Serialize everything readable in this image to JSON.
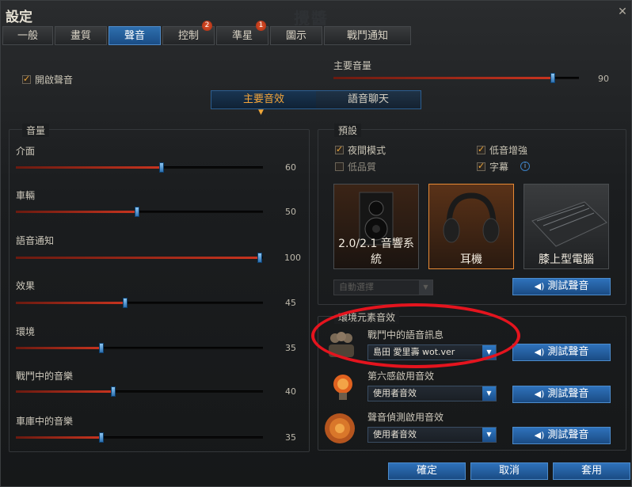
{
  "window": {
    "title": "設定",
    "watermark": "攪醬"
  },
  "tabs": [
    {
      "label": "一般",
      "active": false
    },
    {
      "label": "畫質",
      "active": false
    },
    {
      "label": "聲音",
      "active": true
    },
    {
      "label": "控制",
      "active": false,
      "badge": "2"
    },
    {
      "label": "準星",
      "active": false,
      "badge": "1"
    },
    {
      "label": "圖示",
      "active": false
    },
    {
      "label": "戰鬥通知",
      "active": false
    }
  ],
  "enable_sound": {
    "label": "開啟聲音",
    "checked": true
  },
  "master_volume": {
    "label": "主要音量",
    "value": "90",
    "level": 0.9
  },
  "subtabs": [
    {
      "label": "主要音效",
      "active": true
    },
    {
      "label": "語音聊天",
      "active": false
    }
  ],
  "volume_panel": {
    "title": "音量",
    "sliders": [
      {
        "label": "介面",
        "value": "60",
        "level": 0.6
      },
      {
        "label": "車輛",
        "value": "50",
        "level": 0.5
      },
      {
        "label": "語音通知",
        "value": "100",
        "level": 1.0
      },
      {
        "label": "效果",
        "value": "45",
        "level": 0.45
      },
      {
        "label": "環境",
        "value": "35",
        "level": 0.35
      },
      {
        "label": "戰鬥中的音樂",
        "value": "40",
        "level": 0.4
      },
      {
        "label": "車庫中的音樂",
        "value": "35",
        "level": 0.35
      }
    ]
  },
  "presets": {
    "title": "預設",
    "options": [
      {
        "label": "夜間模式",
        "checked": true,
        "enabled": true
      },
      {
        "label": "低音增強",
        "checked": true,
        "enabled": true
      },
      {
        "label": "低品質",
        "checked": false,
        "enabled": false
      },
      {
        "label": "字幕",
        "checked": true,
        "enabled": true
      }
    ],
    "info_icon": "i",
    "devices": [
      {
        "label": "2.0/2.1 音響系統",
        "icon": "speaker-icon",
        "selected": false
      },
      {
        "label": "耳機",
        "icon": "headphones-icon",
        "selected": true
      },
      {
        "label": "膝上型電腦",
        "icon": "laptop-icon",
        "selected": false
      }
    ],
    "auto_select": "自動選擇",
    "test_button": "測試聲音"
  },
  "ambient": {
    "title": "環境元素音效",
    "items": [
      {
        "label": "戰鬥中的語音訊息",
        "select": "島田 愛里壽 wot.ver",
        "icon": "crew-icon",
        "button": "測試聲音"
      },
      {
        "label": "第六感啟用音效",
        "select": "使用者音效",
        "icon": "lightbulb-icon",
        "button": "測試聲音"
      },
      {
        "label": "聲音偵測啟用音效",
        "select": "使用者音效",
        "icon": "radar-icon",
        "button": "測試聲音"
      }
    ]
  },
  "footer": {
    "ok": "確定",
    "cancel": "取消",
    "apply": "套用"
  },
  "colors": {
    "accent": "#f0a83a",
    "button_blue": "#2f72bb",
    "slider_fill": "#c8341f",
    "annotation": "#e4141e"
  }
}
